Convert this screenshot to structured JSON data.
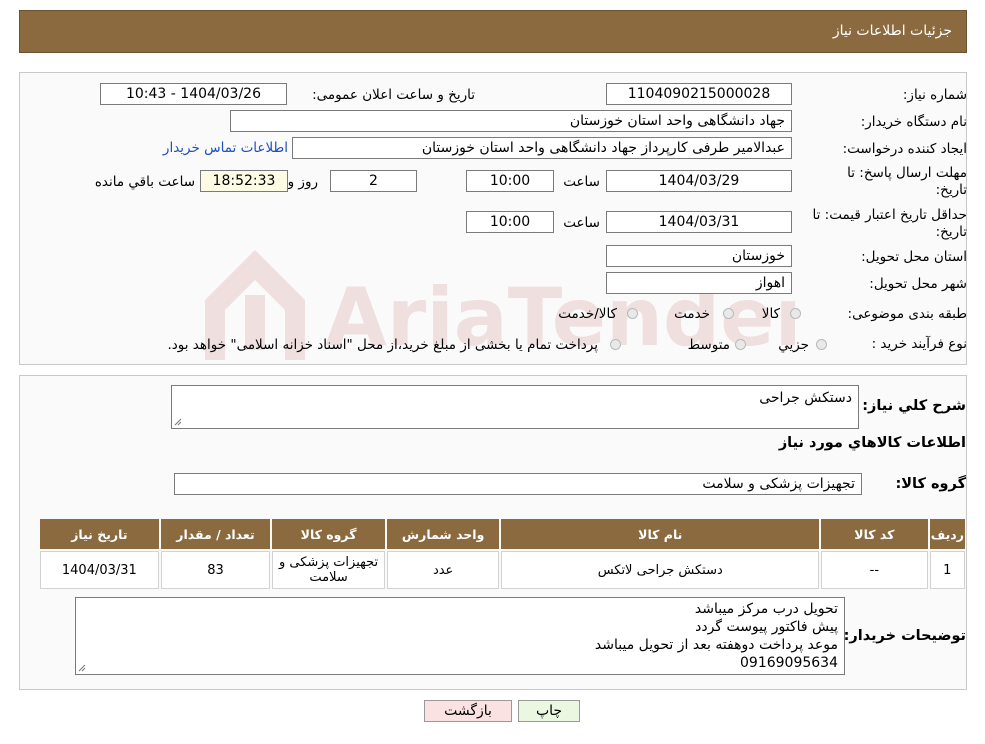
{
  "header": {
    "title": "جزئیات اطلاعات نیاز"
  },
  "form": {
    "need_number_label": "شماره نیاز:",
    "need_number": "1104090215000028",
    "announce_label": "تاریخ و ساعت اعلان عمومی:",
    "announce_value": "1404/03/26 - 10:43",
    "buyer_org_label": "نام دستگاه خریدار:",
    "buyer_org": "جهاد دانشگاهی واحد استان خوزستان",
    "creator_label": "ایجاد کننده درخواست:",
    "creator": "عبدالامیر طرفی کارپرداز جهاد دانشگاهی واحد استان خوزستان",
    "contact_link": "اطلاعات تماس خریدار",
    "deadline_label_1": "مهلت ارسال پاسخ: تا",
    "deadline_label_2": "تاریخ:",
    "deadline_date": "1404/03/29",
    "time_label": "ساعت",
    "deadline_time": "10:00",
    "days_value": "2",
    "days_label": "روز و",
    "remaining_time": "18:52:33",
    "remaining_label": "ساعت باقي مانده",
    "validity_label_1": "حداقل تاریخ اعتبار قیمت: تا",
    "validity_label_2": "تاریخ:",
    "validity_date": "1404/03/31",
    "validity_time": "10:00",
    "province_label": "استان محل تحویل:",
    "province": "خوزستان",
    "city_label": "شهر محل تحویل:",
    "city": "اهواز",
    "category_label": "طبقه بندی موضوعی:",
    "category_options": [
      "کالا",
      "خدمت",
      "کالا/خدمت"
    ],
    "process_label": "نوع فرآیند خرید :",
    "process_options": [
      "جزیي",
      "متوسط"
    ],
    "process_note": "پرداخت تمام یا بخشی از مبلغ خرید،از محل \"اسناد خزانه اسلامی\" خواهد بود."
  },
  "summary": {
    "desc_label": "شرح کلي نیاز:",
    "desc_value": "دستکش جراحی",
    "goods_info_title": "اطلاعات کالاهاي مورد نیاز",
    "goods_group_label": "گروه کالا:",
    "goods_group_value": "تجهیزات پزشکی و سلامت"
  },
  "table": {
    "headers": [
      "ردیف",
      "کد کالا",
      "نام کالا",
      "واحد شمارش",
      "گروه کالا",
      "تعداد / مقدار",
      "تاریخ نیاز"
    ],
    "rows": [
      [
        "1",
        "--",
        "دستکش جراحی لاتکس",
        "عدد",
        "تجهیزات پزشکی و سلامت",
        "83",
        "1404/03/31"
      ]
    ]
  },
  "buyer_notes": {
    "label": "توضیحات خریدار:",
    "lines": [
      "تحویل درب مرکز میباشد",
      "پیش فاکتور پیوست گردد",
      "موعد پرداخت دوهفته بعد از تحویل میباشد",
      "09169095634"
    ]
  },
  "buttons": {
    "print": "چاپ",
    "back": "بازگشت"
  },
  "watermark": {
    "text": "AriaTender.neT"
  },
  "colors": {
    "header_bg": "#8b6a3f",
    "link": "#1e4fbf",
    "print_btn": "#eaf8e2",
    "back_btn": "#fbe2e2"
  }
}
